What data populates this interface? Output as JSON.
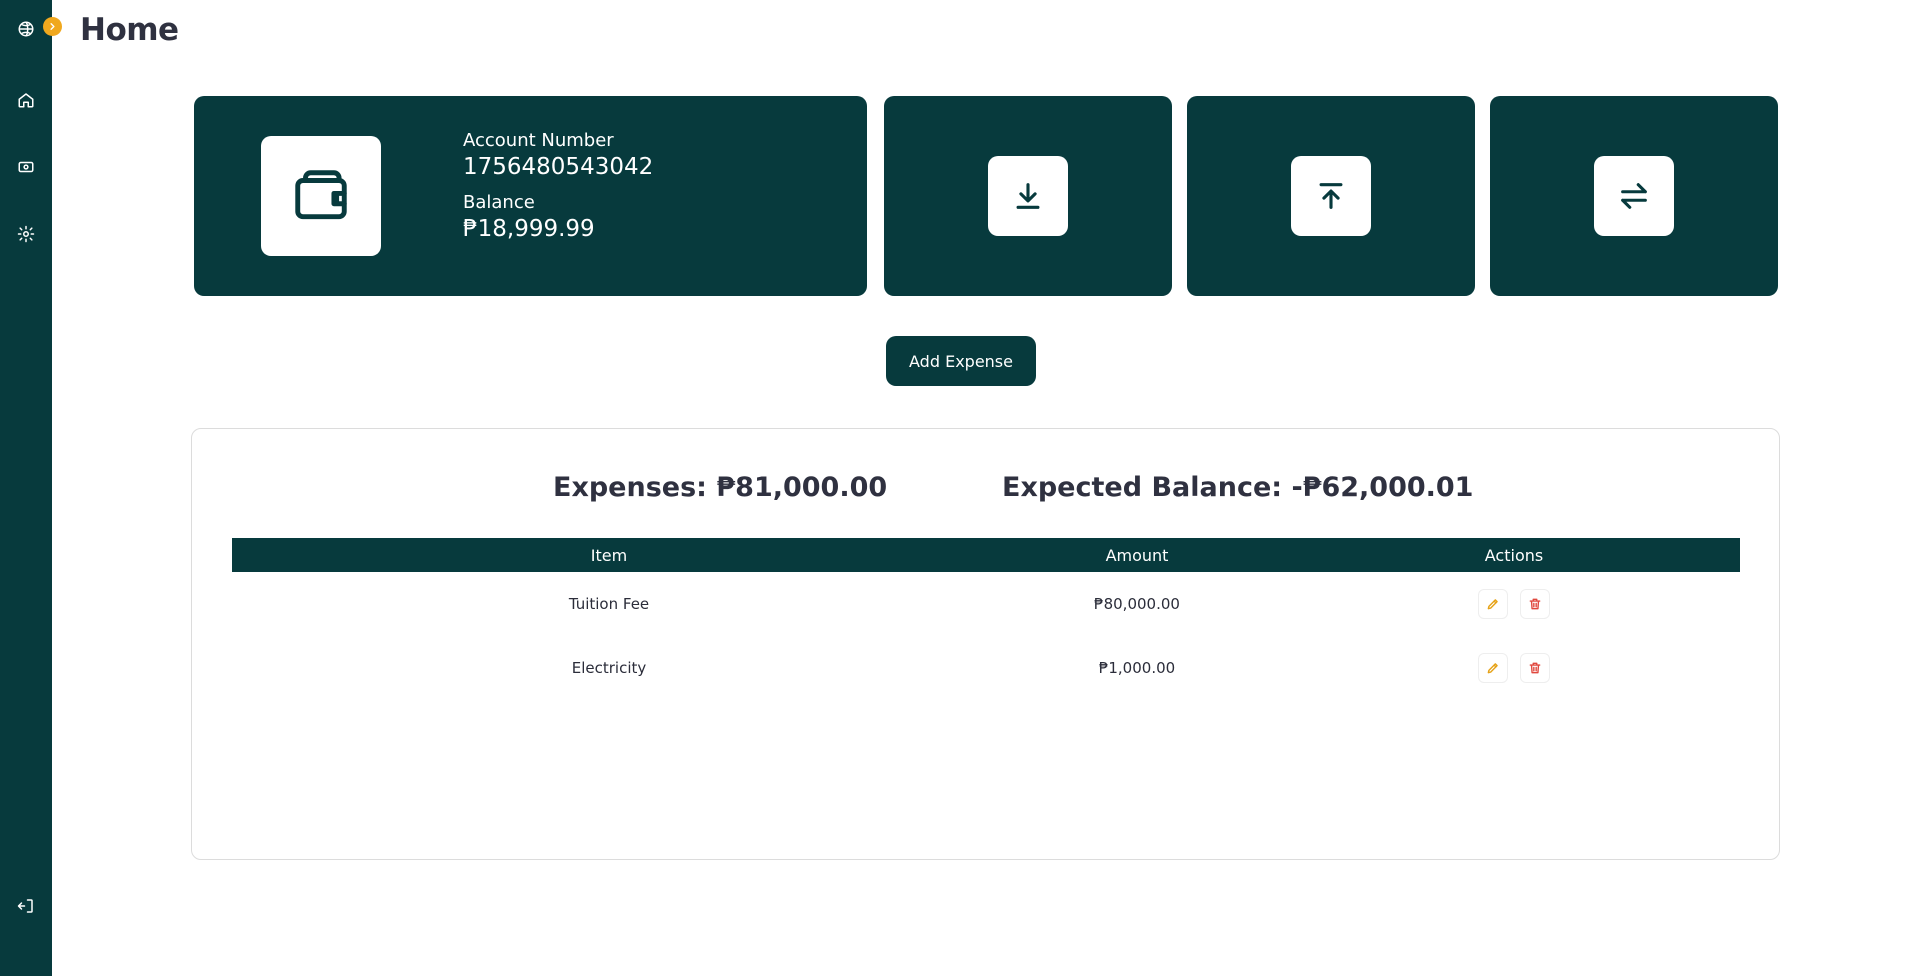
{
  "page": {
    "title": "Home"
  },
  "sidebar": {
    "items": [
      {
        "name": "home",
        "icon": "home-icon"
      },
      {
        "name": "cash",
        "icon": "cash-icon"
      },
      {
        "name": "settings",
        "icon": "gear-icon"
      },
      {
        "name": "logout",
        "icon": "logout-icon"
      }
    ]
  },
  "account": {
    "number_label": "Account Number",
    "number": "1756480543042",
    "balance_label": "Balance",
    "balance": "₱18,999.99"
  },
  "actions": [
    {
      "name": "deposit",
      "icon": "download-icon"
    },
    {
      "name": "withdraw",
      "icon": "upload-icon"
    },
    {
      "name": "transfer",
      "icon": "transfer-icon"
    }
  ],
  "add_expense_label": "Add Expense",
  "summary": {
    "expenses": "Expenses: ₱81,000.00",
    "expected_balance": "Expected Balance: -₱62,000.01"
  },
  "table": {
    "headers": [
      "Item",
      "Amount",
      "Actions"
    ],
    "rows": [
      {
        "item": "Tuition Fee",
        "amount": "₱80,000.00"
      },
      {
        "item": "Electricity",
        "amount": "₱1,000.00"
      }
    ]
  },
  "colors": {
    "primary": "#073a3d",
    "accent": "#f0a81e",
    "edit": "#e6a217",
    "delete": "#e0483e",
    "title": "#2f3140"
  }
}
